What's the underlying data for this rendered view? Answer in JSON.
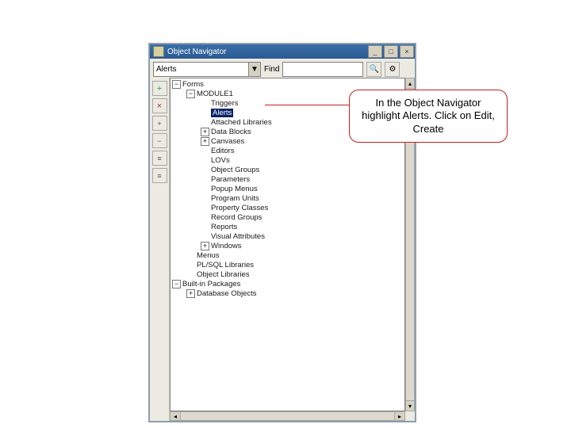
{
  "window": {
    "title": "Object Navigator",
    "buttons": {
      "min": "_",
      "max": "□",
      "close": "×"
    }
  },
  "toolbar": {
    "combo_value": "Alerts",
    "combo_arrow": "▼",
    "find_label": "Find",
    "tool1": "🔍",
    "tool2": "⚙"
  },
  "sidebar": {
    "add": "+",
    "del": "×",
    "b1": "+",
    "b2": "−",
    "b3": "≡",
    "b4": "≡"
  },
  "tree": {
    "items": [
      {
        "lvl": 0,
        "tw": "−",
        "label": "Forms"
      },
      {
        "lvl": 1,
        "tw": "−",
        "label": "MODULE1"
      },
      {
        "lvl": 2,
        "tw": "",
        "label": "Triggers"
      },
      {
        "lvl": 2,
        "tw": "",
        "label": "Alerts",
        "hl": true
      },
      {
        "lvl": 2,
        "tw": "",
        "label": "Attached Libraries"
      },
      {
        "lvl": 2,
        "tw": "+",
        "label": "Data Blocks"
      },
      {
        "lvl": 2,
        "tw": "+",
        "label": "Canvases"
      },
      {
        "lvl": 2,
        "tw": "",
        "label": "Editors"
      },
      {
        "lvl": 2,
        "tw": "",
        "label": "LOVs"
      },
      {
        "lvl": 2,
        "tw": "",
        "label": "Object Groups"
      },
      {
        "lvl": 2,
        "tw": "",
        "label": "Parameters"
      },
      {
        "lvl": 2,
        "tw": "",
        "label": "Popup Menus"
      },
      {
        "lvl": 2,
        "tw": "",
        "label": "Program Units"
      },
      {
        "lvl": 2,
        "tw": "",
        "label": "Property Classes"
      },
      {
        "lvl": 2,
        "tw": "",
        "label": "Record Groups"
      },
      {
        "lvl": 2,
        "tw": "",
        "label": "Reports"
      },
      {
        "lvl": 2,
        "tw": "",
        "label": "Visual Attributes"
      },
      {
        "lvl": 2,
        "tw": "+",
        "label": "Windows"
      },
      {
        "lvl": 1,
        "tw": "",
        "label": "Menus"
      },
      {
        "lvl": 1,
        "tw": "",
        "label": "PL/SQL Libraries"
      },
      {
        "lvl": 1,
        "tw": "",
        "label": "Object Libraries"
      },
      {
        "lvl": 0,
        "tw": "−",
        "label": "Built-in Packages"
      },
      {
        "lvl": 1,
        "tw": "+",
        "label": "Database Objects"
      }
    ]
  },
  "callout": {
    "text": "In the Object Navigator highlight Alerts. Click on Edit, Create"
  },
  "scroll": {
    "up": "▴",
    "down": "▾",
    "left": "◂",
    "right": "▸"
  }
}
